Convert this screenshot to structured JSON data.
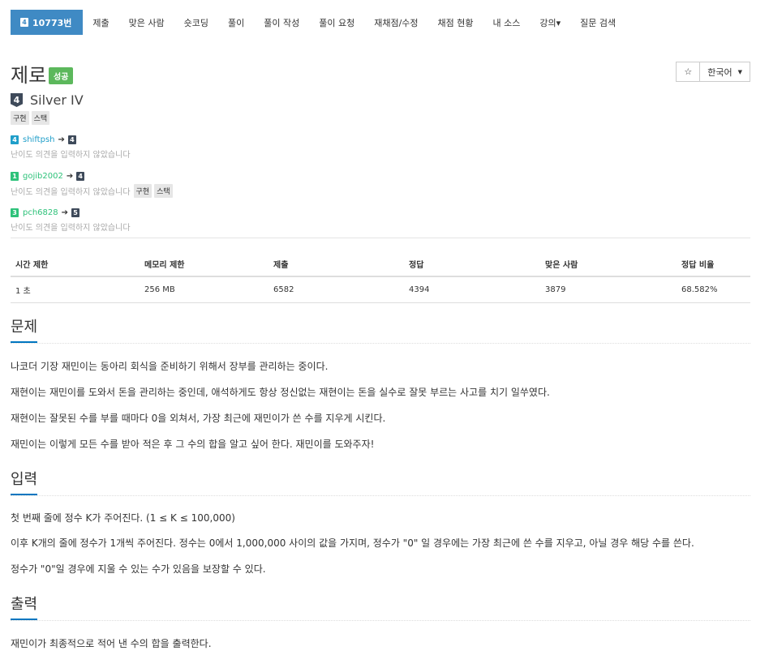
{
  "nav": {
    "active": "10773번",
    "active_tier": "4",
    "items": [
      "제출",
      "맞은 사람",
      "숏코딩",
      "풀이",
      "풀이 작성",
      "풀이 요청",
      "재채점/수정",
      "채점 현황",
      "내 소스",
      "강의▾",
      "질문 검색"
    ]
  },
  "problem": {
    "title": "제로",
    "result_label": "성공",
    "star": "☆",
    "language": "한국어",
    "tier_number": "4",
    "tier_name": "Silver IV",
    "tags": [
      "구현",
      "스택"
    ]
  },
  "opinions": [
    {
      "user": "shiftpsh",
      "from": "4",
      "to": "4",
      "note": "난이도 의견을 입력하지 않았습니다",
      "tags": []
    },
    {
      "user": "gojib2002",
      "from": "1",
      "to": "4",
      "note": "난이도 의견을 입력하지 않았습니다",
      "tags": [
        "구현",
        "스택"
      ]
    },
    {
      "user": "pch6828",
      "from": "3",
      "to": "5",
      "note": "난이도 의견을 입력하지 않았습니다",
      "tags": []
    }
  ],
  "stats": {
    "headers": [
      "시간 제한",
      "메모리 제한",
      "제출",
      "정답",
      "맞은 사람",
      "정답 비율"
    ],
    "values": [
      "1 초",
      "256 MB",
      "6582",
      "4394",
      "3879",
      "68.582%"
    ]
  },
  "sections": {
    "problem_title": "문제",
    "problem_text": [
      "나코더 기장 재민이는 동아리 회식을 준비하기 위해서 장부를 관리하는 중이다.",
      "재현이는 재민이를 도와서 돈을 관리하는 중인데, 애석하게도 항상 정신없는 재현이는 돈을 실수로 잘못 부르는 사고를 치기 일쑤였다.",
      "재현이는 잘못된 수를 부를 때마다 0을 외쳐서, 가장 최근에 재민이가 쓴 수를 지우게 시킨다.",
      "재민이는 이렇게 모든 수를 받아 적은 후 그 수의 합을 알고 싶어 한다. 재민이를 도와주자!"
    ],
    "input_title": "입력",
    "input_text": [
      "첫 번째 줄에 정수 K가 주어진다. (1 ≤ K ≤ 100,000)",
      "이후 K개의 줄에 정수가 1개씩 주어진다. 정수는 0에서 1,000,000 사이의 값을 가지며, 정수가 \"0\" 일 경우에는 가장 최근에 쓴 수를 지우고, 아닐 경우 해당 수를 쓴다.",
      "정수가 \"0\"일 경우에 지울 수 있는 수가 있음을 보장할 수 있다."
    ],
    "output_title": "출력",
    "output_text": [
      "재민이가 최종적으로 적어 낸 수의 합을 출력한다."
    ]
  },
  "colors": {
    "nav_active": "#3f8ac4",
    "success": "#5cb85c",
    "silver": "#3e4a5a",
    "bronze_user": "#1f9ec9",
    "gold_user": "#2ec27a",
    "section_underline": "#0076c0"
  }
}
